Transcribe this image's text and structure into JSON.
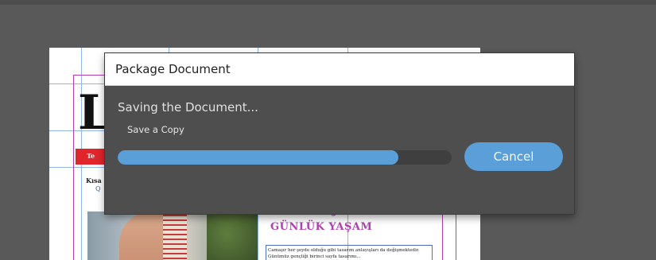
{
  "document": {
    "big_letter": "L",
    "red_bar_text": "Te",
    "kisa_label": "Kısa",
    "kisa_sub": "Q",
    "headline_line1": "TEKNOLOJİ İLE",
    "headline_line2": "GÜNLÜK YAŞAM",
    "article_text": "Camaşır her şeyde olduğu gibi tasarım anlayışları da değişmektedir. Günümüz gençliği birinci sayfa tasarımı..."
  },
  "dialog": {
    "title": "Package Document",
    "status": "Saving the Document...",
    "substatus": "Save a Copy",
    "progress": 0.84,
    "cancel_label": "Cancel"
  },
  "colors": {
    "accent": "#5b9fd8",
    "dialog_bg": "#4e4e4e",
    "pasteboard": "#595959"
  }
}
